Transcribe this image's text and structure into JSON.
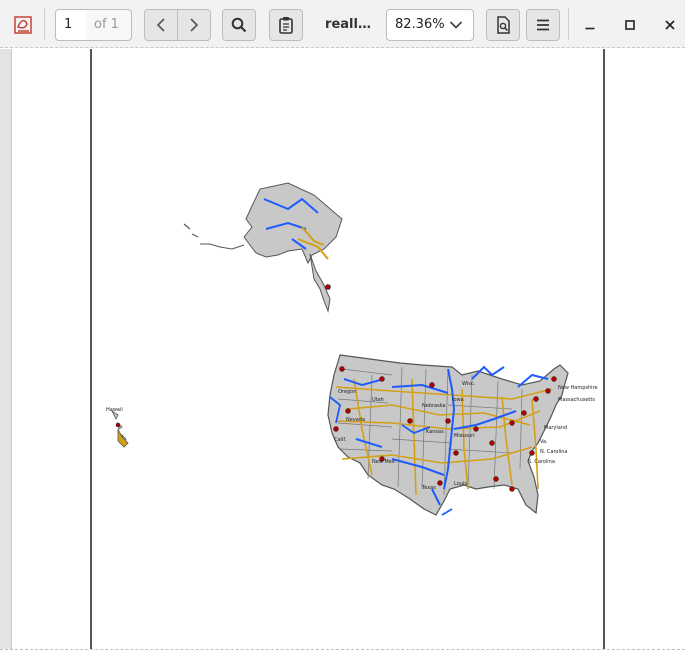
{
  "toolbar": {
    "app_icon": "pdf-reader-icon",
    "page_number": "1",
    "page_of": "of 1",
    "prev_icon": "chevron-left-icon",
    "next_icon": "chevron-right-icon",
    "search_icon": "search-icon",
    "annotate_icon": "clipboard-icon",
    "doc_title": "reall…",
    "zoom_value": "82.36%",
    "zoom_icon": "chevron-down-icon",
    "doc_properties_icon": "document-search-icon",
    "menu_icon": "hamburger-menu-icon",
    "window_controls": [
      "minimize-icon",
      "maximize-icon",
      "close-icon"
    ]
  },
  "document": {
    "map_labels": {
      "hawaii": "Hawaii",
      "oregon": "Oregon",
      "nevada": "Nevada",
      "california": "Calif.",
      "utah": "Utah",
      "nebraska": "Nebraska",
      "kansas": "Kansas",
      "missouri": "Missouri",
      "new_mexico": "New Mex.",
      "texas": "Texas",
      "louisiana": "Louis.",
      "wisconsin": "Wisc.",
      "iowa": "Iowa",
      "new_hampshire": "New Hampshire",
      "massachusetts": "Massachusetts",
      "maryland": "Maryland",
      "virginia": "Va.",
      "north_carolina": "N. Carolina",
      "south_carolina": "S. Carolina"
    },
    "colors": {
      "land": "#c8c8c8",
      "border": "#555555",
      "rivers": "#1e5cff",
      "highways": "#d4a017",
      "cities": "#b00000"
    }
  }
}
